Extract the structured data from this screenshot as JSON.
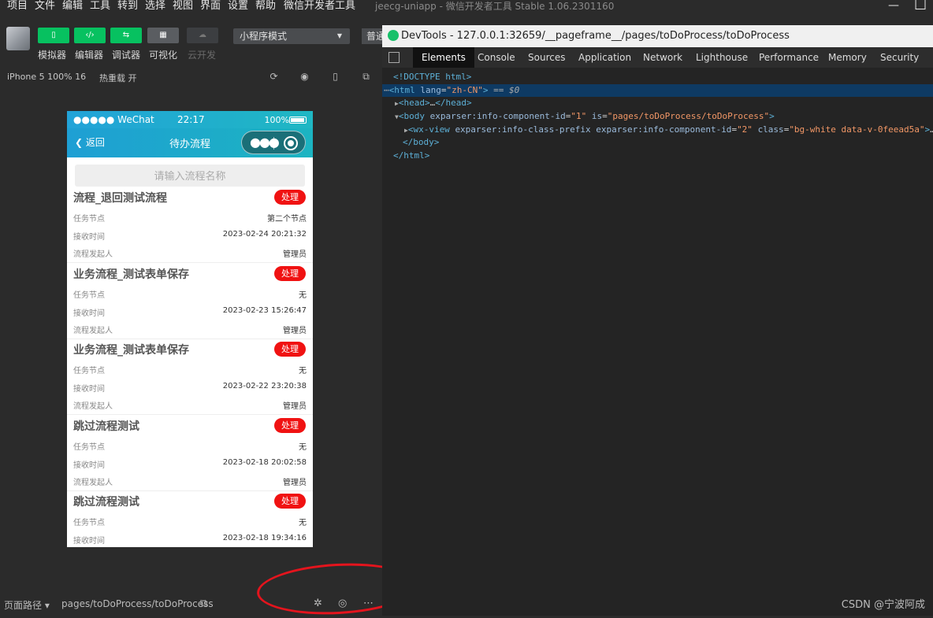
{
  "menubar": {
    "items": [
      "项目",
      "文件",
      "编辑",
      "工具",
      "转到",
      "选择",
      "视图",
      "界面",
      "设置",
      "帮助",
      "微信开发者工具"
    ],
    "window_title": "jeecg-uniapp - 微信开发者工具 Stable 1.06.2301160",
    "minimize": "—",
    "maximize": "☐"
  },
  "toolbar": {
    "buttons": [
      {
        "label": "模拟器",
        "icon": "phone-icon"
      },
      {
        "label": "编辑器",
        "icon": "code-icon"
      },
      {
        "label": "调试器",
        "icon": "debug-icon"
      },
      {
        "label": "可视化",
        "icon": "layout-icon"
      },
      {
        "label": "云开发",
        "icon": "cloud-icon"
      }
    ],
    "mode_select": "小程序模式",
    "normal_btn": "普通"
  },
  "device_bar": {
    "device": "iPhone 5 100% 16",
    "hot_reload": "热重载 开"
  },
  "phone": {
    "status": {
      "carrier": "●●●●● WeChat",
      "time": "22:17",
      "battery": "100%"
    },
    "nav": {
      "back": "返回",
      "title": "待办流程"
    },
    "search_placeholder": "请输入流程名称",
    "row_labels": {
      "node": "任务节点",
      "time": "接收时间",
      "initiator": "流程发起人"
    },
    "action": "处理",
    "cards": [
      {
        "title": "流程_退回测试流程",
        "node": "第二个节点",
        "time": "2023-02-24 20:21:32",
        "initiator": "管理员"
      },
      {
        "title": "业务流程_测试表单保存",
        "node": "无",
        "time": "2023-02-23 15:26:47",
        "initiator": "管理员"
      },
      {
        "title": "业务流程_测试表单保存",
        "node": "无",
        "time": "2023-02-22 23:20:38",
        "initiator": "管理员"
      },
      {
        "title": "跳过流程测试",
        "node": "无",
        "time": "2023-02-18 20:02:58",
        "initiator": "管理员"
      },
      {
        "title": "跳过流程测试",
        "node": "无",
        "time": "2023-02-18 19:34:16",
        "initiator": ""
      }
    ]
  },
  "bottom_bar": {
    "path_label": "页面路径 ▾",
    "path": "pages/toDoProcess/toDoProcess"
  },
  "devtools": {
    "title": "DevTools - 127.0.0.1:32659/__pageframe__/pages/toDoProcess/toDoProcess",
    "tabs": [
      "Elements",
      "Console",
      "Sources",
      "Application",
      "Network",
      "Lighthouse",
      "Performance",
      "Memory",
      "Security"
    ],
    "active_tab": "Elements"
  },
  "watermark": "CSDN @宁波阿成"
}
